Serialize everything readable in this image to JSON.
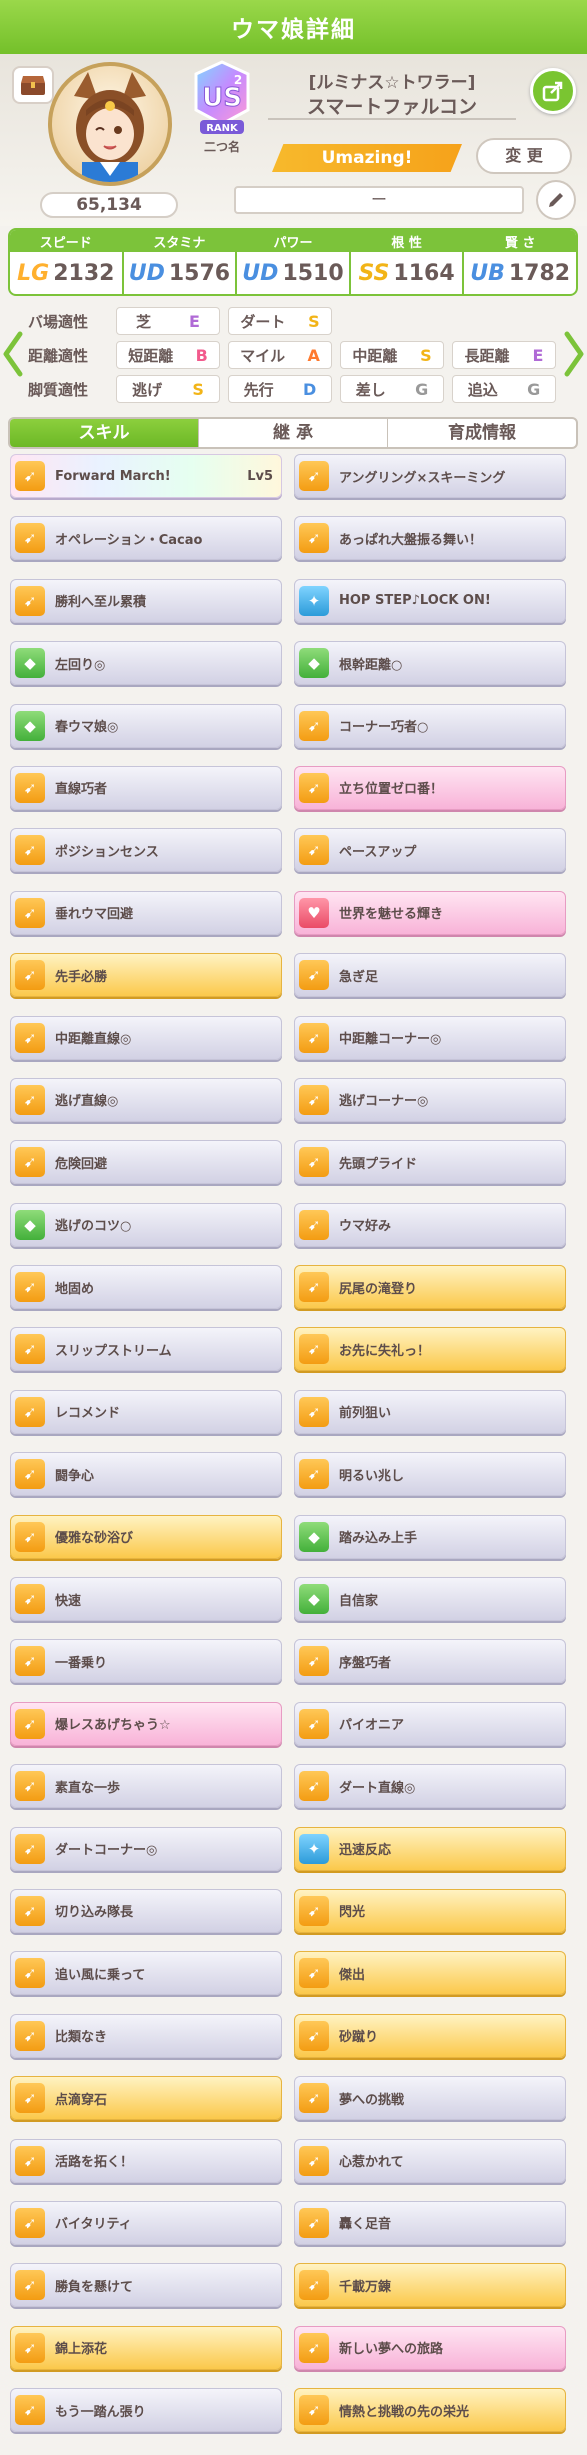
{
  "header": {
    "title": "ウマ娘詳細"
  },
  "profile": {
    "fans": "65,134",
    "rank_title": "二つ名",
    "epithet": "[ルミナス☆トワラー]",
    "name": "スマートファルコン",
    "title_badge": "Umazing!",
    "change_label": "変 更",
    "memo": "ー",
    "rank": "US2",
    "rank_word": "RANK"
  },
  "stats": [
    {
      "label": "スピード",
      "grade": "LG",
      "value": "2132",
      "color": "#ffb02e"
    },
    {
      "label": "スタミナ",
      "grade": "UD",
      "value": "1576",
      "color": "#4a8fe0"
    },
    {
      "label": "パワー",
      "grade": "UD",
      "value": "1510",
      "color": "#4a8fe0"
    },
    {
      "label": "根 性",
      "grade": "SS",
      "value": "1164",
      "color": "#f2b417"
    },
    {
      "label": "賢 さ",
      "grade": "UB",
      "value": "1782",
      "color": "#4a8fe0"
    }
  ],
  "aptitude": {
    "rows": [
      {
        "label": "バ場適性",
        "items": [
          {
            "name": "芝",
            "grade": "E"
          },
          {
            "name": "ダート",
            "grade": "S"
          }
        ]
      },
      {
        "label": "距離適性",
        "items": [
          {
            "name": "短距離",
            "grade": "B"
          },
          {
            "name": "マイル",
            "grade": "A"
          },
          {
            "name": "中距離",
            "grade": "S"
          },
          {
            "name": "長距離",
            "grade": "E"
          }
        ]
      },
      {
        "label": "脚質適性",
        "items": [
          {
            "name": "逃げ",
            "grade": "S"
          },
          {
            "name": "先行",
            "grade": "D"
          },
          {
            "name": "差し",
            "grade": "G"
          },
          {
            "name": "追込",
            "grade": "G"
          }
        ]
      }
    ],
    "grade_colors": {
      "S": "#f2b417",
      "A": "#ff7a2e",
      "B": "#f25a8c",
      "D": "#4a8fe0",
      "E": "#b06ad6",
      "G": "#999999"
    }
  },
  "tabs": [
    "スキル",
    "継 承",
    "育成情報"
  ],
  "skills": [
    {
      "name": "Forward March!",
      "lv": "Lv5",
      "style": "rainbow",
      "icon": "orange"
    },
    {
      "name": "アングリング×スキーミング",
      "style": "normal",
      "icon": "orange"
    },
    {
      "name": "オペレーション・Cacao",
      "style": "normal",
      "icon": "orange"
    },
    {
      "name": "あっぱれ大盤振る舞い！",
      "style": "normal",
      "icon": "orange"
    },
    {
      "name": "勝利へ至ル累積",
      "style": "normal",
      "icon": "orange"
    },
    {
      "name": "HOP STEP♪LOCK ON!",
      "style": "normal",
      "icon": "blue"
    },
    {
      "name": "左回り◎",
      "style": "normal",
      "icon": "green"
    },
    {
      "name": "根幹距離○",
      "style": "normal",
      "icon": "green"
    },
    {
      "name": "春ウマ娘◎",
      "style": "normal",
      "icon": "green"
    },
    {
      "name": "コーナー巧者○",
      "style": "normal",
      "icon": "orange"
    },
    {
      "name": "直線巧者",
      "style": "normal",
      "icon": "orange"
    },
    {
      "name": "立ち位置ゼロ番！",
      "style": "pink",
      "icon": "orange"
    },
    {
      "name": "ポジションセンス",
      "style": "normal",
      "icon": "orange"
    },
    {
      "name": "ペースアップ",
      "style": "normal",
      "icon": "orange"
    },
    {
      "name": "垂れウマ回避",
      "style": "normal",
      "icon": "orange"
    },
    {
      "name": "世界を魅せる輝き",
      "style": "pink",
      "icon": "red"
    },
    {
      "name": "先手必勝",
      "style": "gold",
      "icon": "orange"
    },
    {
      "name": "急ぎ足",
      "style": "normal",
      "icon": "orange"
    },
    {
      "name": "中距離直線◎",
      "style": "normal",
      "icon": "orange"
    },
    {
      "name": "中距離コーナー◎",
      "style": "normal",
      "icon": "orange"
    },
    {
      "name": "逃げ直線◎",
      "style": "normal",
      "icon": "orange"
    },
    {
      "name": "逃げコーナー◎",
      "style": "normal",
      "icon": "orange"
    },
    {
      "name": "危険回避",
      "style": "normal",
      "icon": "orange"
    },
    {
      "name": "先頭プライド",
      "style": "normal",
      "icon": "orange"
    },
    {
      "name": "逃げのコツ○",
      "style": "normal",
      "icon": "green"
    },
    {
      "name": "ウマ好み",
      "style": "normal",
      "icon": "orange"
    },
    {
      "name": "地固め",
      "style": "normal",
      "icon": "orange"
    },
    {
      "name": "尻尾の滝登り",
      "style": "gold",
      "icon": "orange"
    },
    {
      "name": "スリップストリーム",
      "style": "normal",
      "icon": "orange"
    },
    {
      "name": "お先に失礼っ！",
      "style": "gold",
      "icon": "orange"
    },
    {
      "name": "レコメンド",
      "style": "normal",
      "icon": "orange"
    },
    {
      "name": "前列狙い",
      "style": "normal",
      "icon": "orange"
    },
    {
      "name": "闘争心",
      "style": "normal",
      "icon": "orange"
    },
    {
      "name": "明るい兆し",
      "style": "normal",
      "icon": "orange"
    },
    {
      "name": "優雅な砂浴び",
      "style": "gold",
      "icon": "orange"
    },
    {
      "name": "踏み込み上手",
      "style": "normal",
      "icon": "green"
    },
    {
      "name": "快速",
      "style": "normal",
      "icon": "orange"
    },
    {
      "name": "自信家",
      "style": "normal",
      "icon": "green"
    },
    {
      "name": "一番乗り",
      "style": "normal",
      "icon": "orange"
    },
    {
      "name": "序盤巧者",
      "style": "normal",
      "icon": "orange"
    },
    {
      "name": "爆レスあげちゃう☆",
      "style": "pink",
      "icon": "orange"
    },
    {
      "name": "パイオニア",
      "style": "normal",
      "icon": "orange"
    },
    {
      "name": "素直な一歩",
      "style": "normal",
      "icon": "orange"
    },
    {
      "name": "ダート直線◎",
      "style": "normal",
      "icon": "orange"
    },
    {
      "name": "ダートコーナー◎",
      "style": "normal",
      "icon": "orange"
    },
    {
      "name": "迅速反応",
      "style": "gold",
      "icon": "blue"
    },
    {
      "name": "切り込み隊長",
      "style": "normal",
      "icon": "orange"
    },
    {
      "name": "閃光",
      "style": "gold",
      "icon": "orange"
    },
    {
      "name": "追い風に乗って",
      "style": "normal",
      "icon": "orange"
    },
    {
      "name": "傑出",
      "style": "gold",
      "icon": "orange"
    },
    {
      "name": "比類なき",
      "style": "normal",
      "icon": "orange"
    },
    {
      "name": "砂蹴り",
      "style": "gold",
      "icon": "orange"
    },
    {
      "name": "点滴穿石",
      "style": "gold",
      "icon": "orange"
    },
    {
      "name": "夢への挑戦",
      "style": "normal",
      "icon": "orange"
    },
    {
      "name": "活路を拓く！",
      "style": "normal",
      "icon": "orange"
    },
    {
      "name": "心惹かれて",
      "style": "normal",
      "icon": "orange"
    },
    {
      "name": "バイタリティ",
      "style": "normal",
      "icon": "orange"
    },
    {
      "name": "轟く足音",
      "style": "normal",
      "icon": "orange"
    },
    {
      "name": "勝負を懸けて",
      "style": "normal",
      "icon": "orange"
    },
    {
      "name": "千載万錬",
      "style": "gold",
      "icon": "orange"
    },
    {
      "name": "錦上添花",
      "style": "gold",
      "icon": "orange"
    },
    {
      "name": "新しい夢への旅路",
      "style": "pink",
      "icon": "orange"
    },
    {
      "name": "もう一踏ん張り",
      "style": "normal",
      "icon": "orange"
    },
    {
      "name": "情熱と挑戦の先の栄光",
      "style": "gold",
      "icon": "orange"
    }
  ]
}
